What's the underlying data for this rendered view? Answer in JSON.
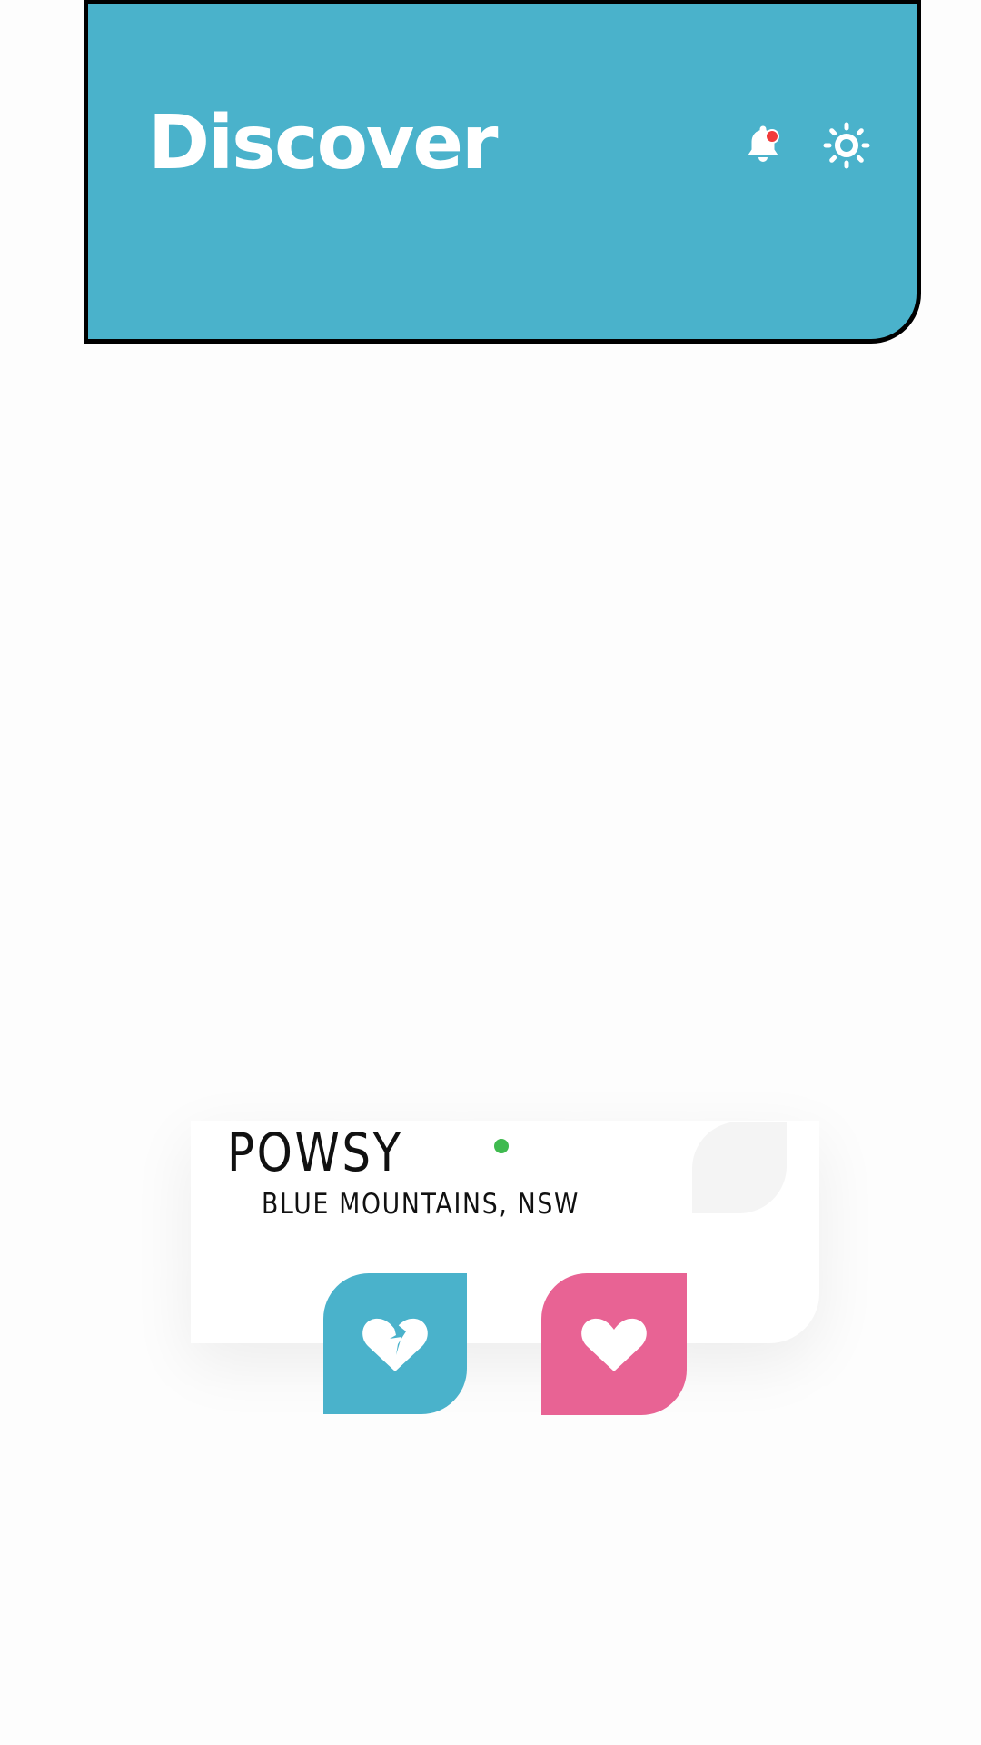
{
  "header": {
    "title": "Discover",
    "bell_icon": "bell-icon",
    "has_notification": true,
    "settings_icon": "gear-icon"
  },
  "profile_card": {
    "name": "POWSY",
    "location": "BLUE MOUNTAINS, NSW",
    "online": true
  },
  "actions": {
    "dislike_icon": "broken-heart-icon",
    "like_icon": "heart-icon"
  },
  "colors": {
    "header_background": "#4ab2cb",
    "dislike_button": "#4ab2cb",
    "like_button": "#e86394",
    "online_indicator": "#3fba4f",
    "notification_dot": "#f03a3a"
  }
}
